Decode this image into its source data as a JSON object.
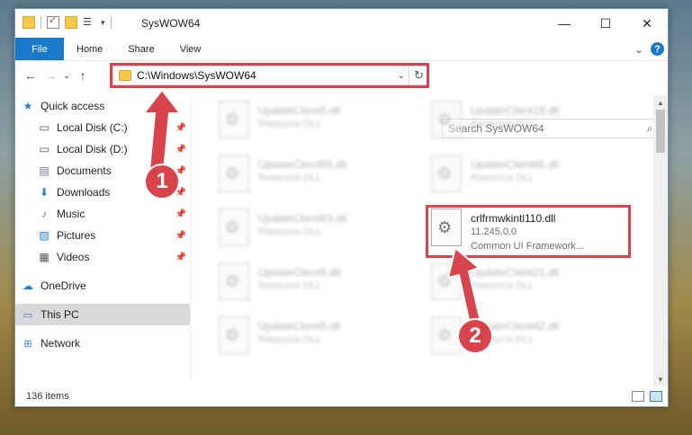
{
  "window": {
    "title": "SysWOW64",
    "minimize": "—",
    "maximize": "☐",
    "close": "✕"
  },
  "ribbon": {
    "tabs": [
      "File",
      "Home",
      "Share",
      "View"
    ],
    "expand": "⌄",
    "help": "?"
  },
  "nav": {
    "back": "←",
    "forward": "→",
    "recent": "⌄",
    "up": "↑",
    "address": "C:\\Windows\\SysWOW64",
    "address_dropdown": "⌄",
    "refresh": "↻",
    "search_placeholder": "Search SysWOW64",
    "search_icon": "⌕"
  },
  "sidebar": {
    "items": [
      {
        "label": "Quick access",
        "icon": "star-icon",
        "glyph": "★",
        "color": "#2b7dd7"
      },
      {
        "label": "Local Disk (C:)",
        "icon": "drive-icon",
        "glyph": "▭",
        "color": "#555",
        "pinned": true
      },
      {
        "label": "Local Disk (D:)",
        "icon": "drive-icon",
        "glyph": "▭",
        "color": "#555",
        "pinned": true
      },
      {
        "label": "Documents",
        "icon": "documents-icon",
        "glyph": "▤",
        "color": "#6c7b8b",
        "pinned": true
      },
      {
        "label": "Downloads",
        "icon": "downloads-icon",
        "glyph": "⬇",
        "color": "#2b7dd7",
        "pinned": true
      },
      {
        "label": "Music",
        "icon": "music-icon",
        "glyph": "♪",
        "color": "#2b7dd7",
        "pinned": true
      },
      {
        "label": "Pictures",
        "icon": "pictures-icon",
        "glyph": "▨",
        "color": "#2b7dd7",
        "pinned": true
      },
      {
        "label": "Videos",
        "icon": "videos-icon",
        "glyph": "▦",
        "color": "#555",
        "pinned": true
      },
      {
        "label": "OneDrive",
        "icon": "onedrive-icon",
        "glyph": "☁",
        "color": "#2b7dd7"
      },
      {
        "label": "This PC",
        "icon": "computer-icon",
        "glyph": "🖥",
        "color": "#2b7dd7",
        "selected": true
      },
      {
        "label": "Network",
        "icon": "network-icon",
        "glyph": "🖧",
        "color": "#2b7dd7"
      }
    ],
    "pin_glyph": "📌"
  },
  "files": [
    {
      "name": "UpdateClient5.dll",
      "type": "Resource DLL"
    },
    {
      "name": "UpdateClient19.dll",
      "type": "Resource DLL"
    },
    {
      "name": "UpdateClient65.dll",
      "type": "Resource DLL"
    },
    {
      "name": "UpdateClient65.dll",
      "type": "Resource DLL"
    },
    {
      "name": "UpdateClient63.dll",
      "type": "Resource DLL"
    },
    {
      "name": "crlfrmwkintl110.dll",
      "version": "11.245.0.0",
      "description": "Common UI Framework...",
      "highlighted": true
    },
    {
      "name": "UpdateClient5.dll",
      "type": "Resource DLL"
    },
    {
      "name": "UpdateClient21.dll",
      "type": "Resource DLL"
    },
    {
      "name": "UpdateClient5.dll",
      "type": "Resource DLL"
    },
    {
      "name": "UpdateClient42.dll",
      "type": "Resource DLL"
    }
  ],
  "status": {
    "count": "136 items"
  },
  "annotations": {
    "step1": "1",
    "step2": "2",
    "color": "#d8444c"
  }
}
